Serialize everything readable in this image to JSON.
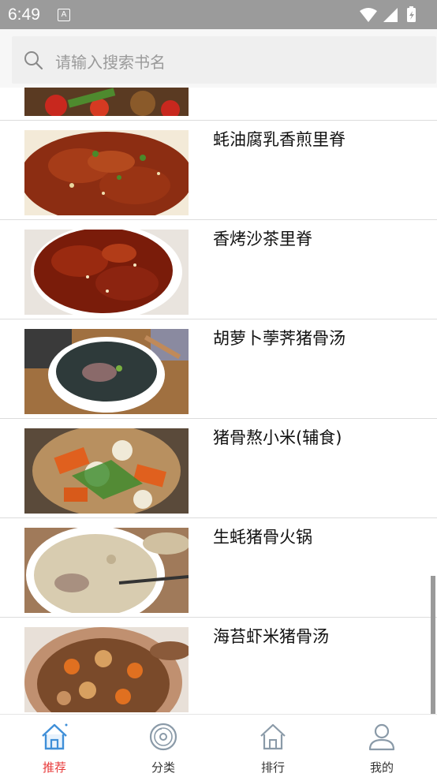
{
  "status_bar": {
    "time": "6:49",
    "app_icon": "A"
  },
  "search": {
    "placeholder": "请输入搜索书名"
  },
  "recipes": [
    {
      "title": ""
    },
    {
      "title": "蚝油腐乳香煎里脊"
    },
    {
      "title": "香烤沙茶里脊"
    },
    {
      "title": "胡萝卜荸荠猪骨汤"
    },
    {
      "title": "猪骨熬小米(辅食)"
    },
    {
      "title": "生蚝猪骨火锅"
    },
    {
      "title": "海苔虾米猪骨汤"
    }
  ],
  "tabs": [
    {
      "label": "推荐",
      "icon": "home-icon",
      "active": true
    },
    {
      "label": "分类",
      "icon": "disc-icon",
      "active": false
    },
    {
      "label": "排行",
      "icon": "home-outline-icon",
      "active": false
    },
    {
      "label": "我的",
      "icon": "user-icon",
      "active": false
    }
  ],
  "colors": {
    "active_tab": "#e83a3a",
    "accent_blue": "#3f8fd8",
    "status_bar": "#9b9b9b"
  }
}
